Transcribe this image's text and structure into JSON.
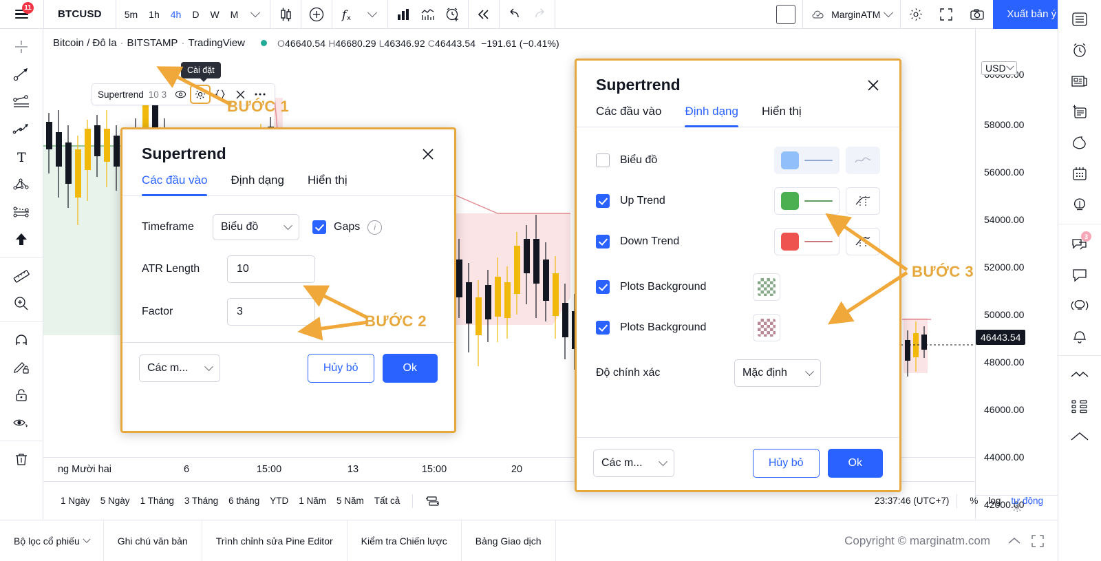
{
  "topbar": {
    "badge_count": "11",
    "symbol": "BTCUSD",
    "resolutions": [
      "5m",
      "1h",
      "4h",
      "D",
      "W",
      "M"
    ],
    "active_resolution": "4h",
    "account_name": "MarginATM",
    "publish_label": "Xuất bản ý tưởng",
    "icons": [
      "candles-icon",
      "plus-circle-icon",
      "indicators-fx-icon",
      "chevron-down-icon",
      "bar-chart-icon",
      "line-chart-icon",
      "alarm-plus-icon",
      "rewind-icon",
      "undo-icon",
      "redo-icon"
    ]
  },
  "chart": {
    "legend": {
      "description": "Bitcoin / Đô la",
      "exchange": "BITSTAMP",
      "provider": "TradingView",
      "separator": "·"
    },
    "ohlc": {
      "open_label": "O",
      "open": "46640.54",
      "high_label": "H",
      "high": "46680.29",
      "low_label": "L",
      "low": "46346.92",
      "close_label": "C",
      "close": "46443.54",
      "change": "−191.61 (−0.41%)"
    },
    "tooltip": "Cài đặt",
    "indicator_legend": {
      "name": "Supertrend",
      "params": "10 3",
      "icons": [
        "eye-icon",
        "settings-gear-icon",
        "source-code-icon",
        "close-icon",
        "more-options-icon"
      ]
    },
    "price_axis": {
      "currency": "USD",
      "labels": [
        "60000.00",
        "58000.00",
        "56000.00",
        "54000.00",
        "52000.00",
        "50000.00",
        "48000.00",
        "46000.00",
        "44000.00",
        "42000.00"
      ],
      "current_price": "46443.54"
    },
    "time_axis": [
      "ng Mười hai",
      "6",
      "15:00",
      "13",
      "15:00",
      "20"
    ],
    "ranges": [
      "1 Ngày",
      "5 Ngày",
      "1 Tháng",
      "3 Tháng",
      "6 tháng",
      "YTD",
      "1 Năm",
      "5 Năm",
      "Tất cả"
    ],
    "clock": "23:37:46 (UTC+7)",
    "scale_options": [
      "%",
      "log",
      "tự động"
    ],
    "scale_active": "tự động"
  },
  "dialog_inputs": {
    "title": "Supertrend",
    "tabs": [
      "Các đầu vào",
      "Định dạng",
      "Hiển thị"
    ],
    "active_tab": "Các đầu vào",
    "timeframe_label": "Timeframe",
    "timeframe_value": "Biểu đồ",
    "gaps_label": "Gaps",
    "gaps_checked": true,
    "atr_label": "ATR Length",
    "atr_value": "10",
    "factor_label": "Factor",
    "factor_value": "3",
    "defaults_label": "Các m...",
    "cancel_label": "Hủy bỏ",
    "ok_label": "Ok"
  },
  "dialog_style": {
    "title": "Supertrend",
    "tabs": [
      "Các đầu vào",
      "Định dạng",
      "Hiển thị"
    ],
    "active_tab": "Định dạng",
    "rows": [
      {
        "label": "Biểu đồ",
        "checked": false,
        "color": "#90bff9",
        "line_color": "#90bff9",
        "disabled": true
      },
      {
        "label": "Up Trend",
        "checked": true,
        "color": "#4caf50",
        "line_color": "#4caf50",
        "disabled": false
      },
      {
        "label": "Down Trend",
        "checked": true,
        "color": "#ef5350",
        "line_color": "#ef5350",
        "disabled": false
      }
    ],
    "bg_rows": [
      {
        "label": "Plots Background",
        "checked": true,
        "color": "#89a98b"
      },
      {
        "label": "Plots Background",
        "checked": true,
        "color": "#b98a96"
      }
    ],
    "precision_label": "Độ chính xác",
    "precision_value": "Mặc định",
    "defaults_label": "Các m...",
    "cancel_label": "Hủy bỏ",
    "ok_label": "Ok"
  },
  "annotations": {
    "step1": "BƯỚC 1",
    "step2": "BƯỚC 2",
    "step3": "BƯỚC 3",
    "color": "#e6a83c"
  },
  "bottombar": {
    "items": [
      "Bộ lọc cổ phiếu",
      "Ghi chú văn bản",
      "Trình chỉnh sửa Pine Editor",
      "Kiểm tra Chiến lược",
      "Bảng Giao dịch"
    ],
    "copyright": "Copyright © marginatm.com"
  },
  "left_toolbar": {
    "icons": [
      "crosshair-icon",
      "trend-line-icon",
      "parallel-channel-icon",
      "pitchfork-icon",
      "text-icon",
      "gann-fan-icon",
      "pattern-icon",
      "arrow-up-icon",
      "ruler-icon",
      "zoom-in-icon",
      "magnet-icon",
      "drawing-lock-icon",
      "lock-icon",
      "hide-drawings-icon",
      "trash-icon"
    ]
  },
  "right_toolbar": {
    "icons": [
      "watchlist-icon",
      "alerts-icon",
      "news-icon",
      "data-window-icon",
      "hotlist-icon",
      "calendar-icon",
      "ideas-icon",
      "chat-icon",
      "private-chat-icon",
      "broadcast-icon",
      "notification-bell-icon",
      "chevron-collapse-icon",
      "object-tree-icon",
      "settings-icon"
    ],
    "chat_badge": "3"
  },
  "colors": {
    "accent_blue": "#2962ff",
    "annotation_orange": "#e6a83c",
    "up_green": "#4caf50",
    "down_red": "#ef5350",
    "candle_up": "#f0b90b",
    "candle_down": "#131722"
  },
  "chart_data": {
    "type": "candlestick",
    "title": "BTCUSD 4h",
    "ylim": [
      41000,
      60500
    ],
    "yticks": [
      42000,
      44000,
      46000,
      48000,
      50000,
      52000,
      54000,
      56000,
      58000,
      60000
    ],
    "xticks": [
      "ng Mười hai",
      "6",
      "15:00",
      "13",
      "15:00",
      "20"
    ],
    "last_price": 46443.54,
    "open": 46640.54,
    "high": 46680.29,
    "low": 46346.92,
    "close": 46443.54,
    "change": -191.61,
    "change_pct": -0.41,
    "overlay": "Supertrend (10, 3)"
  }
}
